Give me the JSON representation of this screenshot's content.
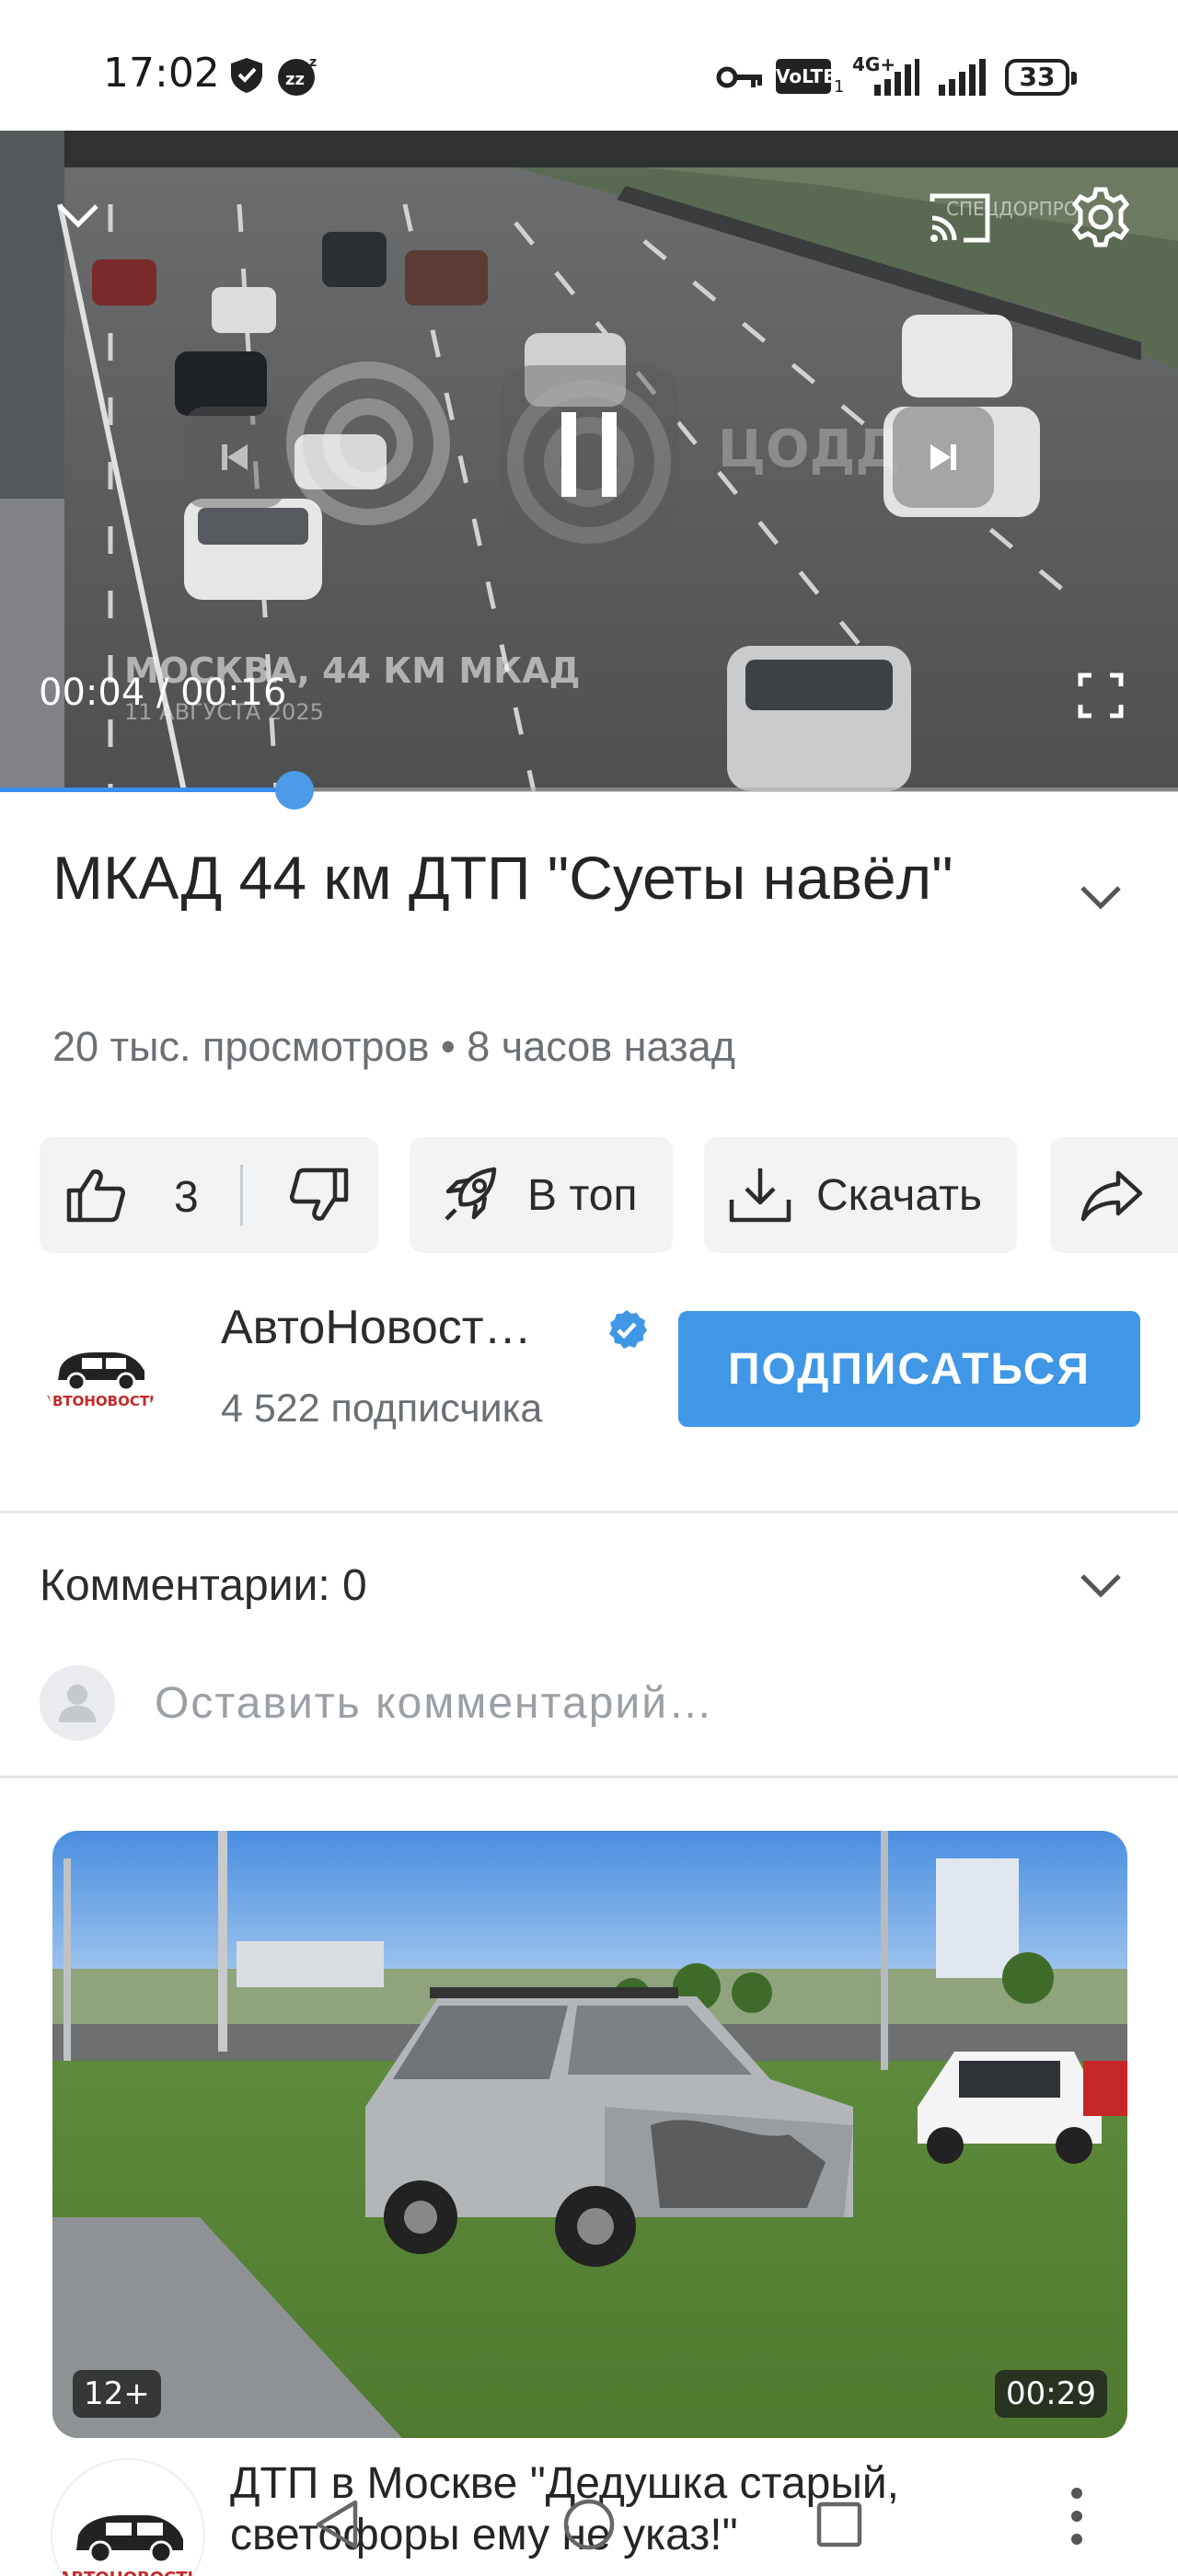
{
  "status_bar": {
    "time": "17:02",
    "volte_label": "VoLTE",
    "volte_sim": "1",
    "network": "4G+",
    "battery": "33"
  },
  "player": {
    "current_time": "00:04",
    "duration": "00:16",
    "time_display": "00:04 / 00:16",
    "progress": 0.25,
    "watermark_brand": "ЦОДД",
    "cam_brand": "СПЕЦДОРПРО",
    "location_caption": "МОСКВА, 44 КМ МКАД",
    "date_caption": "11 АВГУСТА 2025",
    "icons": [
      "chevron-down-icon",
      "cast-icon",
      "settings-gear-icon",
      "previous-icon",
      "pause-icon",
      "next-icon",
      "fullscreen-icon"
    ]
  },
  "video": {
    "title": "МКАД 44 км ДТП \"Суеты навёл\"",
    "meta": "20 тыс. просмотров • 8 часов назад"
  },
  "actions": {
    "like_count": "3",
    "promote_label": "В топ",
    "download_label": "Скачать"
  },
  "channel": {
    "name": "АвтоНовост…",
    "subscribers": "4 522 подписчика",
    "subscribe_label": "ПОДПИСАТЬСЯ",
    "logo_text": "АВТОНОВОСТИ"
  },
  "comments": {
    "label": "Комментарии: 0",
    "placeholder": "Оставить комментарий…"
  },
  "recommended": [
    {
      "title": "ДТП в Москве \"Дедушка старый, светофоры ему не указ!\"",
      "age_rating": "12+",
      "duration": "00:29",
      "channel_logo_text": "АВТОНОВОСТИ"
    }
  ],
  "colors": {
    "accent": "#3f97e6",
    "progress": "#3b8ef0",
    "pill_bg": "#f2f3f5",
    "muted_text": "#6b7075"
  }
}
